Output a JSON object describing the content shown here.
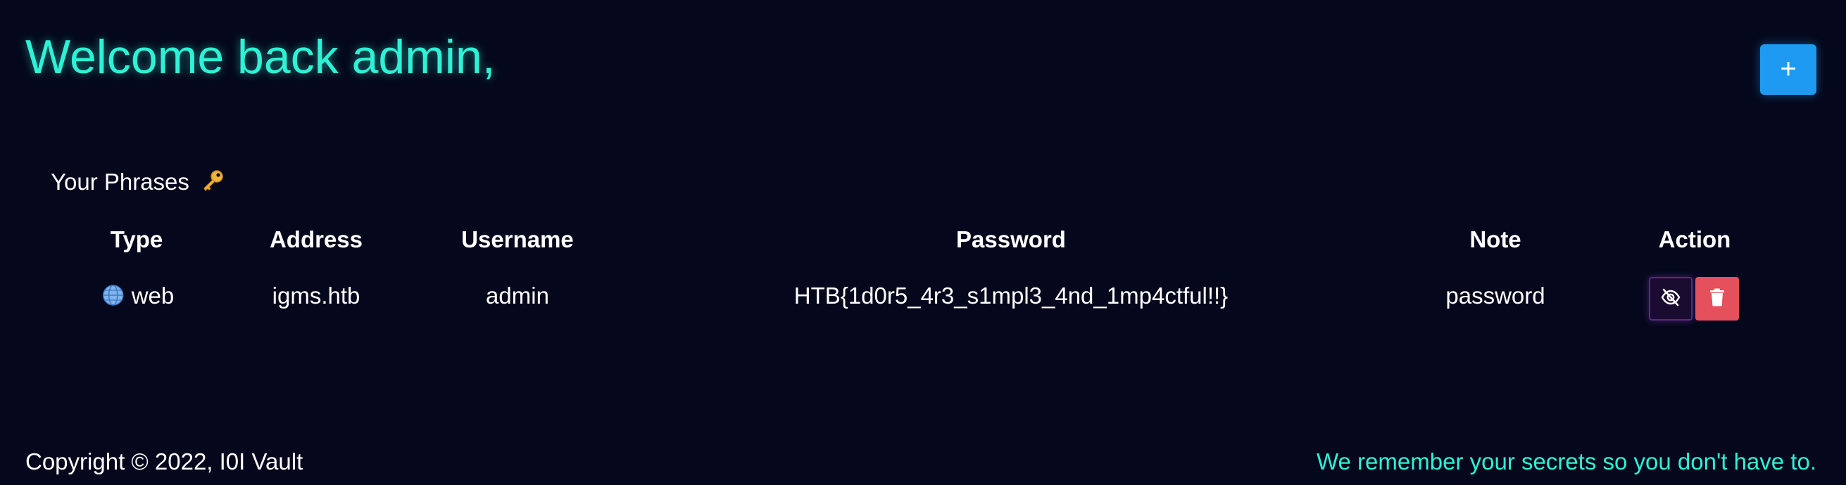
{
  "header": {
    "welcome": "Welcome back admin,",
    "add_label": "+"
  },
  "phrases": {
    "title": "Your Phrases",
    "columns": {
      "type": "Type",
      "address": "Address",
      "username": "Username",
      "password": "Password",
      "note": "Note",
      "action": "Action"
    },
    "rows": [
      {
        "type": "web",
        "type_icon": "globe-icon",
        "address": "igms.htb",
        "username": "admin",
        "password": "HTB{1d0r5_4r3_s1mpl3_4nd_1mp4ctful!!}",
        "note": "password"
      }
    ]
  },
  "footer": {
    "copyright": "Copyright © 2022, I0I Vault",
    "tagline": "We remember your secrets so you don't have to."
  },
  "colors": {
    "background": "#05081c",
    "accent": "#2ef2d6",
    "add_button": "#1e9af2",
    "delete_button": "#e4505b",
    "view_button": "#1a0b30"
  }
}
